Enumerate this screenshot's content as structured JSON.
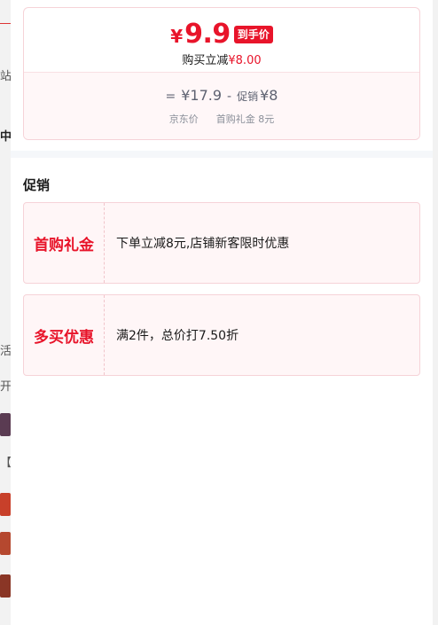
{
  "background_fragments": [
    "站",
    "中",
    "活",
    "开",
    "【"
  ],
  "price": {
    "currency": "¥",
    "final_value": "9.9",
    "final_tag": "到手价",
    "reduce_label": "购买立减",
    "reduce_amount": "¥8.00",
    "formula": {
      "equals": "=",
      "jd_price": "¥17.9",
      "minus": "-",
      "promo_label": "促销",
      "promo_amount": "¥8"
    },
    "captions": {
      "jd_price_caption": "京东价",
      "gift_caption": "首购礼金 8元"
    }
  },
  "promotions": {
    "title": "促销",
    "items": [
      {
        "name": "首购礼金",
        "desc": "下单立减8元,店铺新客限时优惠"
      },
      {
        "name": "多买优惠",
        "desc": "满2件，总价打7.50折"
      }
    ]
  },
  "colors": {
    "accent": "#e8142a",
    "card_border": "#f6d3d8",
    "card_bg": "#fff6f7",
    "muted_text": "#8a8f99"
  }
}
